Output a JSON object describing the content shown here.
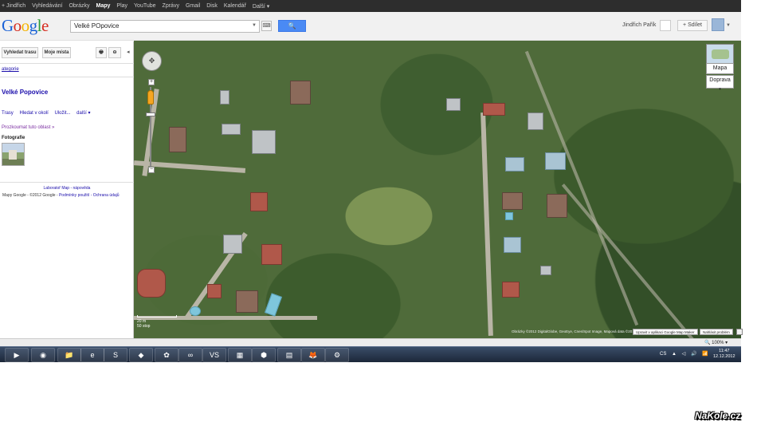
{
  "gbar": {
    "items": [
      "+ Jindřich",
      "Vyhledávání",
      "Obrázky",
      "Mapy",
      "Play",
      "YouTube",
      "Zprávy",
      "Gmail",
      "Disk",
      "Kalendář",
      "Další ▾"
    ],
    "active_index": 3
  },
  "header": {
    "logo": [
      "G",
      "o",
      "o",
      "g",
      "l",
      "e"
    ],
    "search_value": "Velké POpovice",
    "search_button": "🔍",
    "keyboard": "⌨",
    "user_name": "Jindřich Pařík",
    "share_label": "+ Sdílet"
  },
  "left_panel": {
    "route_button": "Vyhledat trasu",
    "places_button": "Moje místa",
    "print_icon": "🖶",
    "link_icon": "⊖",
    "collapse": "◂",
    "category_link": "ategorie",
    "place_title": "Velké Popovice",
    "actions": [
      "Trasy",
      "Hledat v okolí",
      "Uložit...",
      "další ▾"
    ],
    "explore": "Prozkoumat tuto oblast »",
    "photos_label": "Fotografie",
    "lab_links": "Laboratoř Map - nápověda",
    "copyright_prefix": "Mapy Google - ©2012 Google - ",
    "copyright_links": "Podmínky použití - Ochrana údajů"
  },
  "map": {
    "nav": "✥",
    "zoom_in": "+",
    "zoom_out": "−",
    "type_map": "Mapa",
    "type_traffic": "Doprava",
    "scale_m": "20 m",
    "scale_ft": "50 stop",
    "footer": "Obrázky ©2012 DigitalGlobe, GeoEye, Cnes/Spot Image, Mapová data ©2012 Google",
    "mapmaker_button": "Upravit v aplikaci Google Map Maker",
    "report_button": "Nahlásit problém"
  },
  "statusbar": {
    "zoom": "🔍 100% ▾"
  },
  "taskbar": {
    "icons": [
      "▶",
      "◉",
      "📁",
      "e",
      "S",
      "◆",
      "✿",
      "∞",
      "VS",
      "▦",
      "⬢",
      "▤",
      "🦊",
      "⚙"
    ],
    "tray": [
      "CS",
      "▲",
      "◁",
      "🔊",
      "📶"
    ],
    "time": "11:47",
    "date": "12.12.2012"
  },
  "watermark": "NaKole.cz"
}
